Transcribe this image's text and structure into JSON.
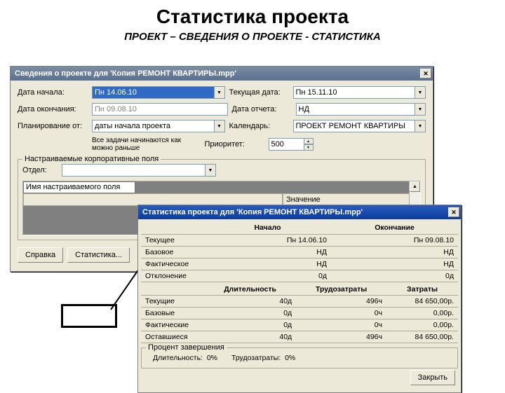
{
  "slide": {
    "title": "Статистика проекта",
    "subtitle": "ПРОЕКТ – СВЕДЕНИЯ О ПРОЕКТЕ - СТАТИСТИКА"
  },
  "dialog1": {
    "title": "Сведения о проекте для 'Копия РЕМОНТ КВАРТИРЫ.mpp'",
    "labels": {
      "start": "Дата начала:",
      "end": "Дата окончания:",
      "planfrom": "Планирование от:",
      "curdate": "Текущая дата:",
      "reportdate": "Дата отчета:",
      "calendar": "Календарь:",
      "priority": "Приоритет:",
      "alltasks": "Все задачи начинаются как можно раньше"
    },
    "values": {
      "start": "Пн 14.06.10",
      "end": "Пн 09.08.10",
      "planfrom": "даты начала проекта",
      "curdate": "Пн 15.11.10",
      "reportdate": "НД",
      "calendar": "ПРОЕКТ РЕМОНТ КВАРТИРЫ",
      "priority": "500"
    },
    "group": {
      "title": "Настраиваемые корпоративные поля",
      "dept": "Отдел:",
      "fieldname": "Имя настраиваемого поля",
      "col2": "Значение"
    },
    "buttons": {
      "help": "Справка",
      "stats": "Статистика..."
    }
  },
  "dialog2": {
    "title": "Статистика проекта для 'Копия РЕМОНТ КВАРТИРЫ.mpp'",
    "headers": {
      "start": "Начало",
      "end": "Окончание",
      "duration": "Длительность",
      "work": "Трудозатраты",
      "cost": "Затраты"
    },
    "rows1": [
      {
        "label": "Текущее",
        "start": "Пн 14.06.10",
        "end": "Пн 09.08.10"
      },
      {
        "label": "Базовое",
        "start": "НД",
        "end": "НД"
      },
      {
        "label": "Фактическое",
        "start": "НД",
        "end": "НД"
      },
      {
        "label": "Отклонение",
        "start": "0д",
        "end": "0д"
      }
    ],
    "rows2": [
      {
        "label": "Текущие",
        "duration": "40д",
        "work": "496ч",
        "cost": "84 650,00р."
      },
      {
        "label": "Базовые",
        "duration": "0д",
        "work": "0ч",
        "cost": "0,00р."
      },
      {
        "label": "Фактические",
        "duration": "0д",
        "work": "0ч",
        "cost": "0,00р."
      },
      {
        "label": "Оставшиеся",
        "duration": "40д",
        "work": "496ч",
        "cost": "84 650,00р."
      }
    ],
    "progress": {
      "title": "Процент завершения",
      "durlabel": "Длительность:",
      "durval": "0%",
      "worklabel": "Трудозатраты:",
      "workval": "0%"
    },
    "close": "Закрыть"
  }
}
